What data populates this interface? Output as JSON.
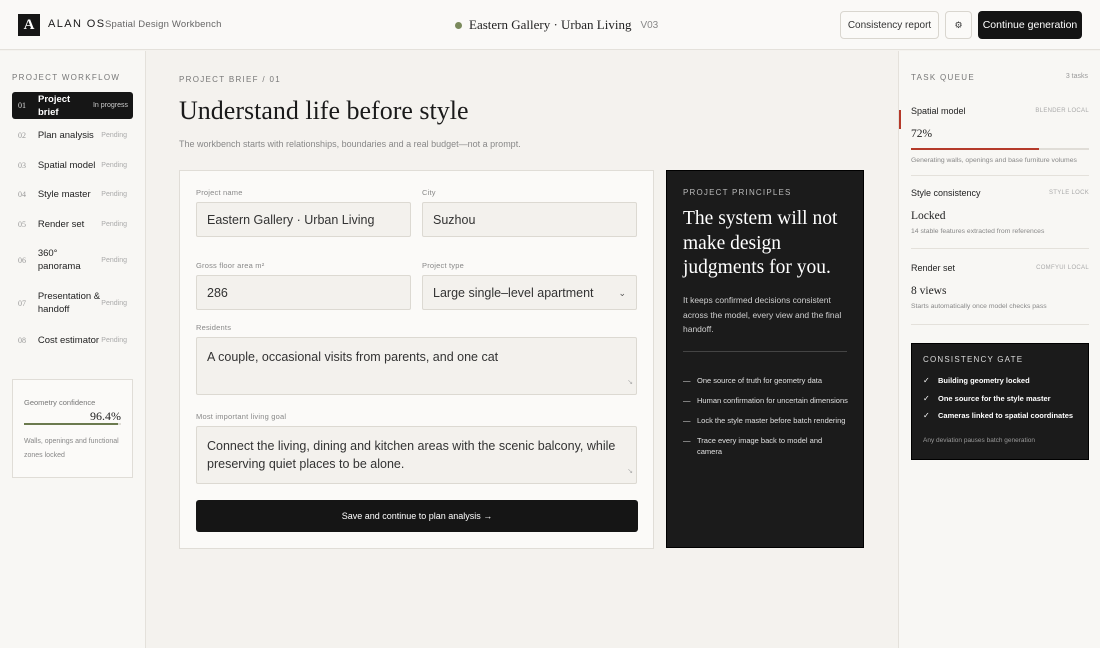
{
  "header": {
    "logo_letter": "A",
    "brand": "ALAN OS",
    "subtitle": "Spatial Design Workbench",
    "project_title": "Eastern Gallery · Urban Living",
    "version": "V03",
    "consistency_report_label": "Consistency report",
    "settings_icon": "⚙",
    "continue_label": "Continue generation",
    "status_color": "#7a8a5c"
  },
  "sidebar": {
    "heading": "PROJECT WORKFLOW",
    "items": [
      {
        "num": "01",
        "label": "Project brief",
        "status": "In progress",
        "active": true
      },
      {
        "num": "02",
        "label": "Plan analysis",
        "status": "Pending"
      },
      {
        "num": "03",
        "label": "Spatial model",
        "status": "Pending"
      },
      {
        "num": "04",
        "label": "Style master",
        "status": "Pending"
      },
      {
        "num": "05",
        "label": "Render set",
        "status": "Pending"
      },
      {
        "num": "06",
        "label": "360° panorama",
        "status": "Pending"
      },
      {
        "num": "07",
        "label": "Presentation & handoff",
        "status": "Pending"
      },
      {
        "num": "08",
        "label": "Cost estimator",
        "status": "Pending"
      }
    ],
    "geometry": {
      "label": "Geometry confidence",
      "value": "96.4%",
      "fraction": 0.964,
      "note": "Walls, openings and functional zones locked"
    }
  },
  "main": {
    "eyebrow": "PROJECT BRIEF / 01",
    "title": "Understand life before style",
    "subtitle": "The workbench starts with relationships, boundaries and a real budget—not a prompt.",
    "form": {
      "project_name_label": "Project name",
      "project_name": "Eastern Gallery · Urban Living",
      "city_label": "City",
      "city": "Suzhou",
      "area_label": "Gross floor area m²",
      "area": "286",
      "type_label": "Project type",
      "type": "Large single–level apartment",
      "residents_label": "Residents",
      "residents": "A couple, occasional visits from parents, and one cat",
      "goal_label": "Most important living goal",
      "goal": "Connect the living, dining and kitchen areas with the scenic balcony, while preserving quiet places to be alone.",
      "save_label": "Save and continue to plan analysis →"
    },
    "principles": {
      "heading": "PROJECT PRINCIPLES",
      "title": "The system will not make design judgments for you.",
      "description": "It keeps confirmed decisions consistent across the model, every view and the final handoff.",
      "items": [
        "One source of truth for geometry data",
        "Human confirmation for uncertain dimensions",
        "Lock the style master before batch rendering",
        "Trace every image back to model and camera"
      ]
    }
  },
  "queue": {
    "heading": "TASK QUEUE",
    "count": "3 tasks",
    "tasks": [
      {
        "name": "Spatial model",
        "tag": "BLENDER LOCAL",
        "value": "72%",
        "progress": 0.72,
        "note": "Generating walls, openings and base furniture volumes"
      },
      {
        "name": "Style consistency",
        "tag": "STYLE LOCK",
        "value": "Locked",
        "note": "14 stable features extracted from references"
      },
      {
        "name": "Render set",
        "tag": "COMFYUI LOCAL",
        "value": "8 views",
        "note": "Starts automatically once model checks pass"
      }
    ],
    "accent_color": "#b53a2a",
    "gate": {
      "heading": "CONSISTENCY GATE",
      "items": [
        "Building geometry locked",
        "One source for the style master",
        "Cameras linked to spatial coordinates"
      ],
      "note": "Any deviation pauses batch generation"
    }
  }
}
